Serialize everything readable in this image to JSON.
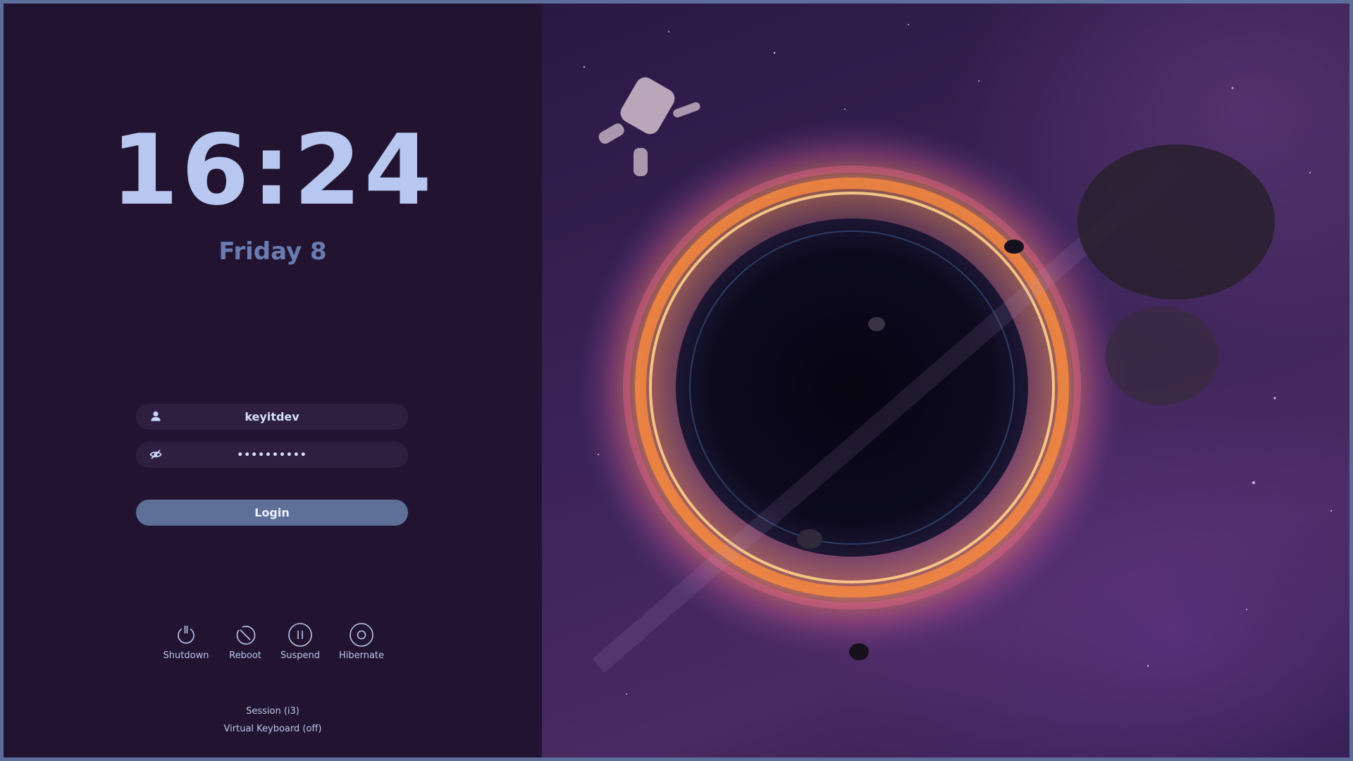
{
  "clock": {
    "time": "16:24",
    "date": "Friday 8"
  },
  "form": {
    "username": "keyitdev",
    "password_masked": "••••••••••",
    "login_label": "Login"
  },
  "power_buttons": [
    {
      "label": "Shutdown",
      "icon": "power-icon"
    },
    {
      "label": "Reboot",
      "icon": "reboot-icon"
    },
    {
      "label": "Suspend",
      "icon": "pause-icon"
    },
    {
      "label": "Hibernate",
      "icon": "hibernate-icon"
    }
  ],
  "footer": {
    "session": "Session (i3)",
    "virtual_keyboard": "Virtual Keyboard (off)"
  },
  "colors": {
    "panel_bg": "#221430",
    "clock": "#b7c7f0",
    "date": "#6a7bb0",
    "button": "#5f7098",
    "border": "#5e6e9c"
  }
}
